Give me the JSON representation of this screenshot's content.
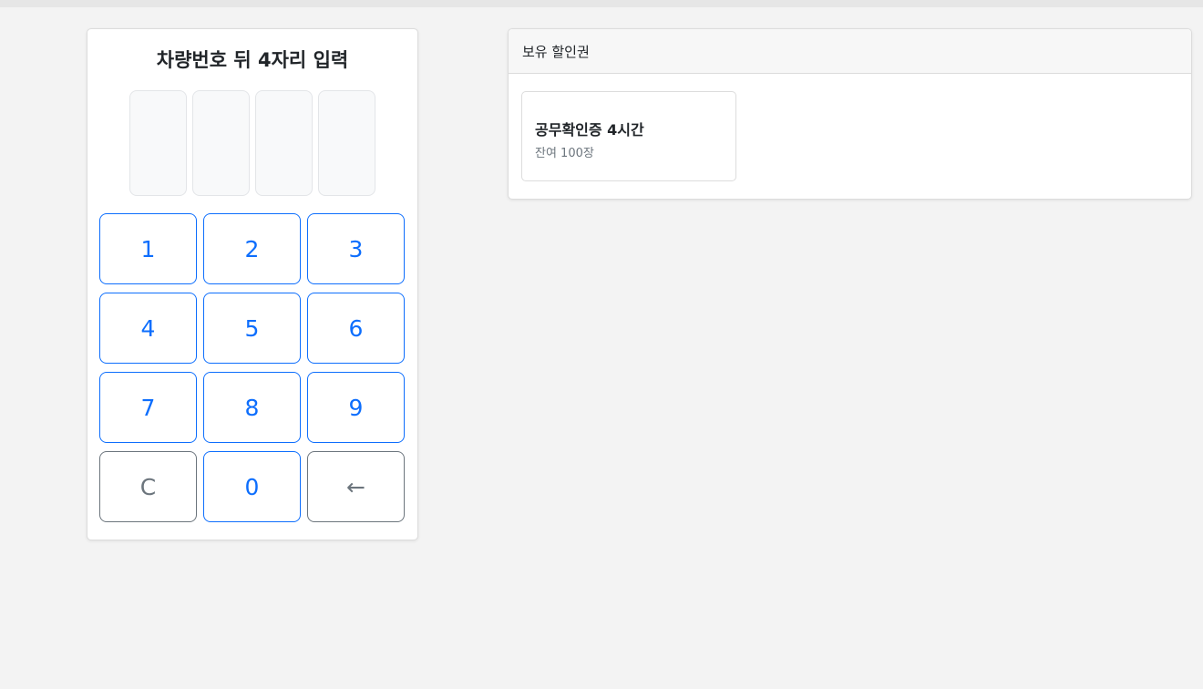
{
  "keypad": {
    "title": "차량번호 뒤 4자리 입력",
    "digits": [
      "",
      "",
      "",
      ""
    ],
    "keys": [
      "1",
      "2",
      "3",
      "4",
      "5",
      "6",
      "7",
      "8",
      "9",
      "C",
      "0",
      "←"
    ]
  },
  "coupons": {
    "header": "보유 할인권",
    "items": [
      {
        "name": "공무확인증 4시간",
        "remaining": "잔여 100장"
      }
    ]
  },
  "colors": {
    "accent": "#0d6efd",
    "secondary": "#6c757d",
    "background": "#f3f3f3"
  }
}
